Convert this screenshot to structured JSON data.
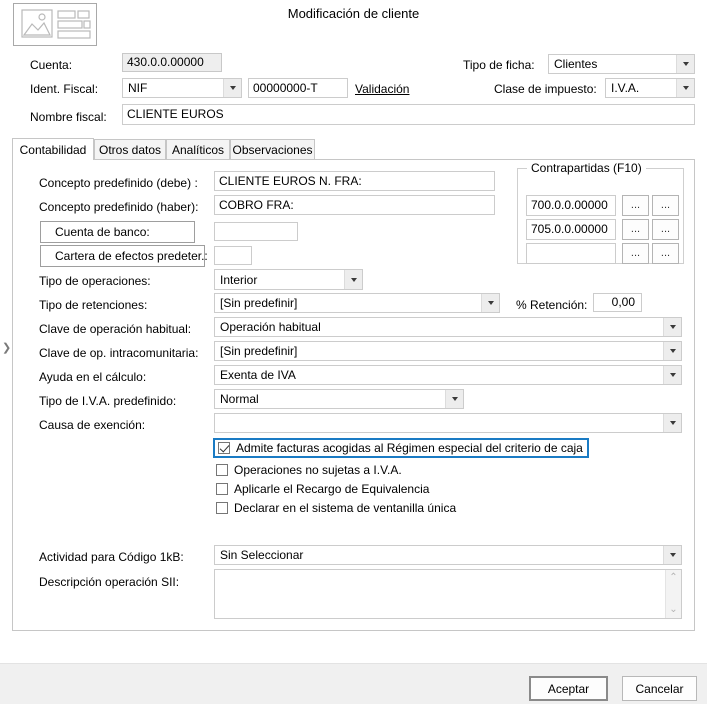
{
  "window": {
    "title": "Modificación de cliente",
    "app_icon": "form-card-icon"
  },
  "header": {
    "cuenta_label": "Cuenta:",
    "cuenta_value": "430.0.0.00000",
    "tipo_ficha_label": "Tipo de ficha:",
    "tipo_ficha_value": "Clientes",
    "ident_fiscal_label": "Ident. Fiscal:",
    "ident_fiscal_type": "NIF",
    "ident_fiscal_number": "00000000-T",
    "validacion_link": "Validación",
    "clase_impuesto_label": "Clase de impuesto:",
    "clase_impuesto_value": "I.V.A.",
    "nombre_fiscal_label": "Nombre fiscal:",
    "nombre_fiscal_value": "CLIENTE EUROS"
  },
  "tabs": [
    {
      "label": "Contabilidad",
      "active": true
    },
    {
      "label": "Otros datos",
      "active": false
    },
    {
      "label": "Analíticos",
      "active": false
    },
    {
      "label": "Observaciones",
      "active": false
    }
  ],
  "contabilidad": {
    "concepto_debe_label": "Concepto predefinido (debe) :",
    "concepto_debe_value": "CLIENTE EUROS N. FRA:",
    "concepto_haber_label": "Concepto predefinido (haber):",
    "concepto_haber_value": "COBRO FRA:",
    "cuenta_banco_button": "Cuenta de banco:",
    "cuenta_banco_value": "",
    "cartera_efectos_button": "Cartera de efectos predeter.:",
    "cartera_efectos_value": "",
    "tipo_operaciones_label": "Tipo de operaciones:",
    "tipo_operaciones_value": "Interior",
    "tipo_retenciones_label": "Tipo de retenciones:",
    "tipo_retenciones_value": "[Sin predefinir]",
    "pct_retencion_label": "% Retención:",
    "pct_retencion_value": "0,00",
    "clave_operacion_label": "Clave de operación habitual:",
    "clave_operacion_value": "Operación habitual",
    "clave_intracom_label": "Clave de op. intracomunitaria:",
    "clave_intracom_value": "[Sin predefinir]",
    "ayuda_calculo_label": "Ayuda en el cálculo:",
    "ayuda_calculo_value": "Exenta de IVA",
    "tipo_iva_label": "Tipo de I.V.A. predefinido:",
    "tipo_iva_value": "Normal",
    "causa_exencion_label": "Causa de exención:",
    "causa_exencion_value": "",
    "actividad_label": "Actividad para Código 1kB:",
    "actividad_value": "Sin Seleccionar",
    "descripcion_sii_label": "Descripción operación SII:",
    "descripcion_sii_value": ""
  },
  "contrapartidas": {
    "title": "Contrapartidas (F10)",
    "rows": [
      {
        "value": "700.0.0.00000",
        "btn1": "...",
        "btn2": "..."
      },
      {
        "value": "705.0.0.00000",
        "btn1": "...",
        "btn2": "..."
      },
      {
        "value": "",
        "btn1": "...",
        "btn2": "..."
      }
    ]
  },
  "checkboxes": [
    {
      "label": "Admite facturas acogidas al Régimen especial del criterio de caja",
      "checked": true,
      "highlighted": true
    },
    {
      "label": "Operaciones no sujetas a I.V.A.",
      "checked": false,
      "highlighted": false
    },
    {
      "label": "Aplicarle el Recargo de Equivalencia",
      "checked": false,
      "highlighted": false
    },
    {
      "label": "Declarar en el sistema de ventanilla única",
      "checked": false,
      "highlighted": false
    }
  ],
  "scrollbar": {
    "up_icon": "chevron-up-icon",
    "down_icon": "chevron-down-icon",
    "up": "⌃",
    "down": "⌄"
  },
  "panel_toggle": {
    "icon": "expand-right-chevron-icon",
    "glyph": "❯"
  },
  "footer": {
    "accept_label": "Aceptar",
    "cancel_label": "Cancelar"
  },
  "colors": {
    "highlight_border": "#1a7bc4",
    "footer_bg": "#f0f0f0",
    "readonly_field_bg": "#eeeeee"
  }
}
